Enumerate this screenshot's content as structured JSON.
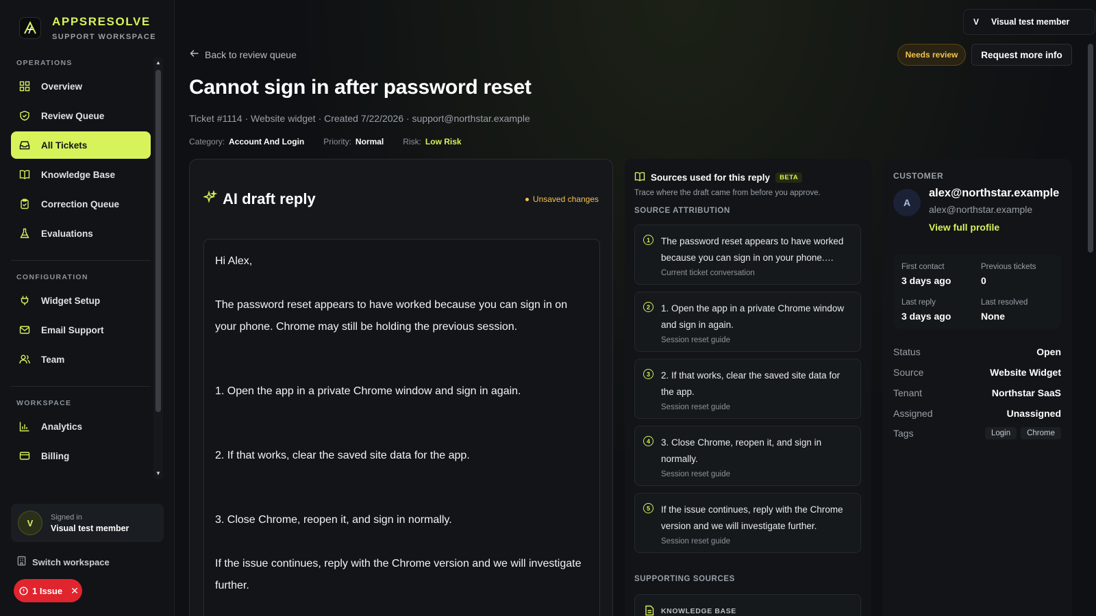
{
  "brand": {
    "name": "APPSRESOLVE",
    "subtitle": "SUPPORT WORKSPACE"
  },
  "sidebar": {
    "sections": [
      {
        "title": "OPERATIONS"
      },
      {
        "title": "CONFIGURATION"
      },
      {
        "title": "WORKSPACE"
      }
    ],
    "items": [
      {
        "label": "Overview",
        "icon": "grid-icon"
      },
      {
        "label": "Review Queue",
        "icon": "shield-check-icon"
      },
      {
        "label": "All Tickets",
        "icon": "inbox-icon",
        "active": true
      },
      {
        "label": "Knowledge Base",
        "icon": "book-icon"
      },
      {
        "label": "Correction Queue",
        "icon": "clipboard-check-icon"
      },
      {
        "label": "Evaluations",
        "icon": "flask-icon"
      },
      {
        "label": "Widget Setup",
        "icon": "plug-icon"
      },
      {
        "label": "Email Support",
        "icon": "mail-icon"
      },
      {
        "label": "Team",
        "icon": "users-icon"
      },
      {
        "label": "Analytics",
        "icon": "bar-chart-icon"
      },
      {
        "label": "Billing",
        "icon": "credit-card-icon"
      }
    ],
    "signed_in_label": "Signed in",
    "signed_in_name": "Visual test member",
    "avatar_initial": "V",
    "switch_workspace": "Switch workspace",
    "issue_label": "1 Issue"
  },
  "topbar": {
    "user_initial": "V",
    "user_name": "Visual test member"
  },
  "header": {
    "back_label": "Back to review queue",
    "status_badge": "Needs review",
    "request_button": "Request more info",
    "title": "Cannot sign in after password reset",
    "meta": "Ticket #1114 · Website widget · Created 7/22/2026 · support@northstar.example",
    "category_label": "Category:",
    "category_value": "Account And Login",
    "priority_label": "Priority:",
    "priority_value": "Normal",
    "risk_label": "Risk:",
    "risk_value": "Low Risk"
  },
  "draft": {
    "title": "AI draft reply",
    "unsaved": "Unsaved changes",
    "paragraphs": [
      "Hi Alex,",
      "The password reset appears to have worked because you can sign in on your phone. Chrome may still be holding the previous session.",
      "1. Open the app in a private Chrome window and sign in again.",
      "2. If that works, clear the saved site data for the app.",
      "3. Close Chrome, reopen it, and sign in normally.",
      "If the issue continues, reply with the Chrome version and we will investigate further."
    ]
  },
  "sources": {
    "title": "Sources used for this reply",
    "beta": "BETA",
    "subtitle": "Trace where the draft came from before you approve.",
    "attribution_label": "SOURCE ATTRIBUTION",
    "items": [
      {
        "num": "1",
        "text": "The password reset appears to have worked because you can sign in on your phone. Chrome may still be holding the previous session.",
        "from": "Current ticket conversation"
      },
      {
        "num": "2",
        "text": "1. Open the app in a private Chrome window and sign in again.",
        "from": "Session reset guide"
      },
      {
        "num": "3",
        "text": "2. If that works, clear the saved site data for the app.",
        "from": "Session reset guide"
      },
      {
        "num": "4",
        "text": "3. Close Chrome, reopen it, and sign in normally.",
        "from": "Session reset guide"
      },
      {
        "num": "5",
        "text": "If the issue continues, reply with the Chrome version and we will investigate further.",
        "from": "Session reset guide"
      }
    ],
    "supporting_label": "SUPPORTING SOURCES",
    "kb_label": "KNOWLEDGE BASE"
  },
  "customer": {
    "label": "CUSTOMER",
    "initial": "A",
    "name": "alex@northstar.example",
    "email": "alex@northstar.example",
    "profile_link": "View full profile",
    "stats": {
      "first_contact_label": "First contact",
      "first_contact_value": "3 days ago",
      "previous_tickets_label": "Previous tickets",
      "previous_tickets_value": "0",
      "last_reply_label": "Last reply",
      "last_reply_value": "3 days ago",
      "last_resolved_label": "Last resolved",
      "last_resolved_value": "None"
    },
    "fields": [
      {
        "label": "Status",
        "value": "Open"
      },
      {
        "label": "Source",
        "value": "Website Widget"
      },
      {
        "label": "Tenant",
        "value": "Northstar SaaS"
      },
      {
        "label": "Assigned",
        "value": "Unassigned"
      }
    ],
    "tags_label": "Tags",
    "tags": [
      "Login",
      "Chrome"
    ]
  },
  "colors": {
    "accent": "#d6f35a",
    "warning": "#f3c451",
    "danger": "#e0252f",
    "background": "#0e1013"
  }
}
